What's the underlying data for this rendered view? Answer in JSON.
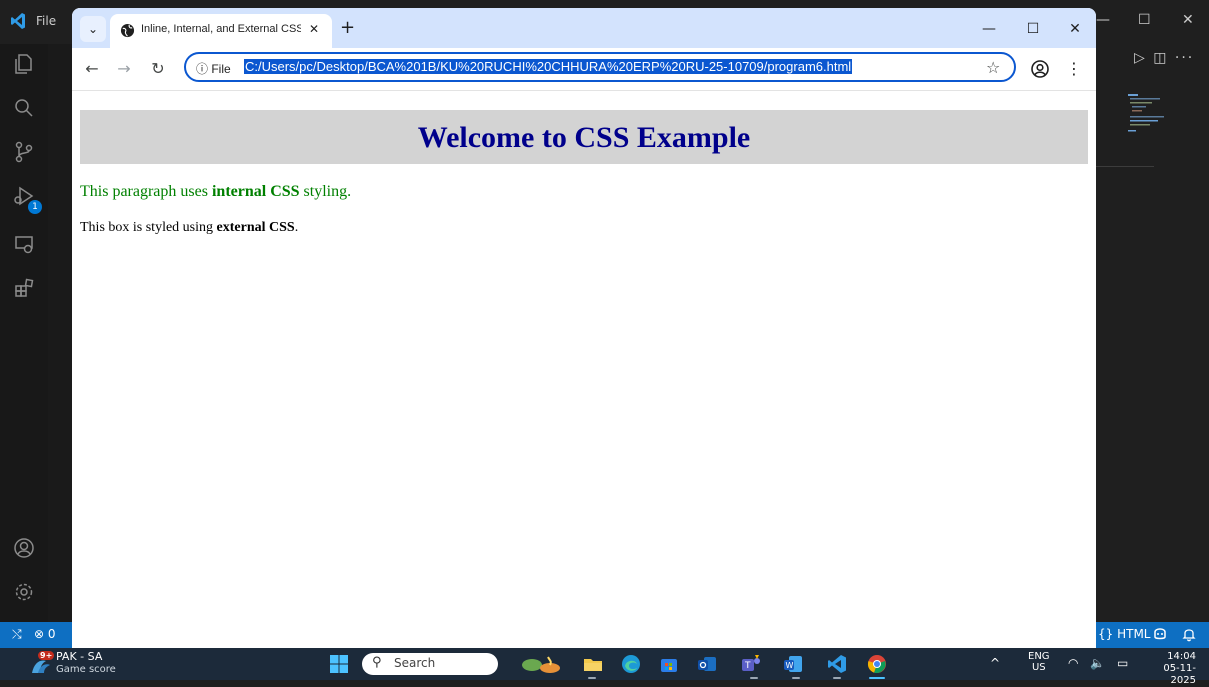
{
  "vscode": {
    "menu_file": "File",
    "status_remote": "⤭",
    "status_errors": "⊗ 0",
    "status_language": "{} HTML",
    "activity_badge": "1",
    "window_controls": {
      "minimize": "—",
      "maximize": "☐",
      "close": "✕"
    },
    "editor_tools": "▷ ◫ ···"
  },
  "browser": {
    "tab_title": "Inline, Internal, and External CSS",
    "tab_search": "⌄",
    "tab_close": "✕",
    "new_tab": "+",
    "window_controls": {
      "minimize": "—",
      "maximize": "☐",
      "close": "✕"
    },
    "nav": {
      "back": "←",
      "forward": "→",
      "reload": "↻"
    },
    "omnibox": {
      "site_info": "ⓘ File",
      "url": "C:/Users/pc/Desktop/BCA%201B/KU%20RUCHI%20CHHURA%20ERP%20RU-25-10709/program6.html"
    },
    "bookmark_star": "☆",
    "menu_dots": "⋮"
  },
  "page": {
    "heading": "Welcome to CSS Example",
    "para1": {
      "prefix": "This paragraph uses ",
      "bold": "internal CSS",
      "suffix": " styling."
    },
    "para2": {
      "prefix": "This box is styled using ",
      "bold": "external CSS",
      "suffix": "."
    },
    "colors": {
      "heading_text": "#00008b",
      "heading_bg": "#d3d3d3",
      "para1_text": "#008000"
    }
  },
  "taskbar": {
    "weather_badge": "9+",
    "weather_title": "PAK - SA",
    "weather_subtitle": "Game score",
    "search_placeholder": "Search",
    "tray_chevron": "^",
    "lang_line1": "ENG",
    "lang_line2": "US",
    "tray_icons": "◠ 🔈 ▭",
    "time": "14:04",
    "date": "05-11-2025"
  }
}
